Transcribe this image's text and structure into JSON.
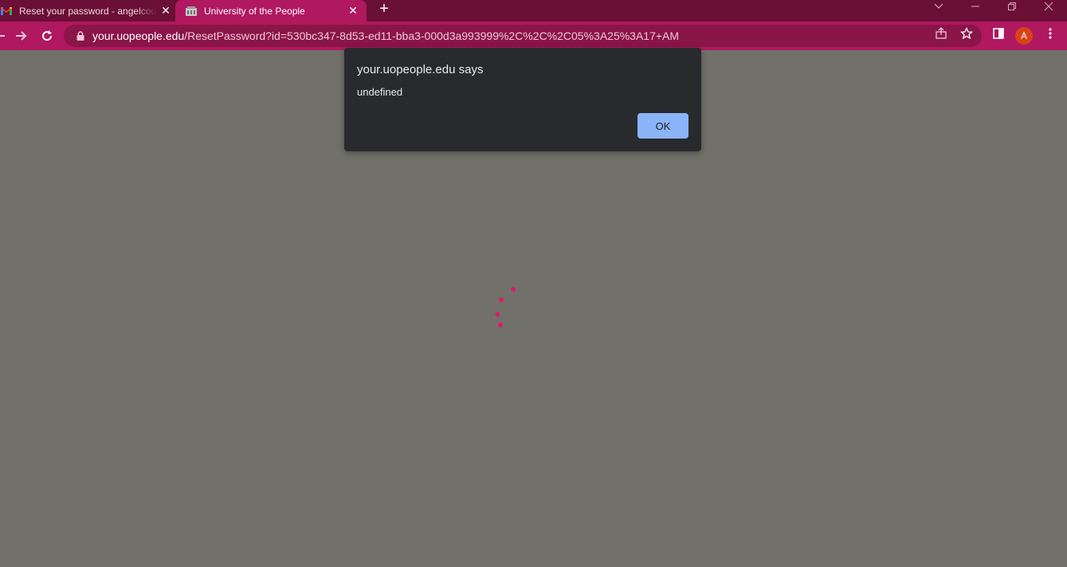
{
  "browser": {
    "tabs": [
      {
        "title": "Reset your password - angelcode",
        "favicon": "gmail-icon",
        "active": false
      },
      {
        "title": "University of the People",
        "favicon": "uopeople-icon",
        "active": true
      }
    ],
    "new_tab_label": "+",
    "address_bar": {
      "host": "your.uopeople.edu",
      "path": "/ResetPassword?id=530bc347-8d53-ed11-bba3-000d3a993999%2C%2C%2C05%3A25%3A17+AM"
    },
    "profile_initial": "A",
    "colors": {
      "tabstrip": "#6a0f35",
      "toolbar": "#b01860",
      "omnibox": "#8a1548",
      "avatar": "#d84315"
    }
  },
  "dialog": {
    "title": "your.uopeople.edu says",
    "message": "undefined",
    "ok_label": "OK",
    "colors": {
      "background": "#292a2d",
      "button": "#8ab4f8"
    }
  },
  "page": {
    "background": "#71716a",
    "spinner_color": "#e0186c"
  }
}
